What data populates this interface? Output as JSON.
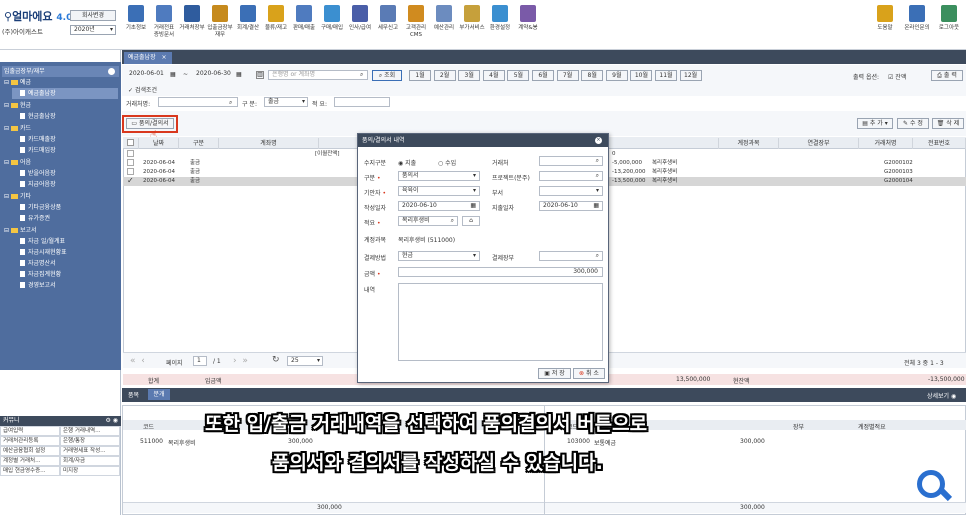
{
  "app": {
    "logo_text": "얼마에요",
    "version": "4.0",
    "company": "(주)아이캐스트",
    "company_change_btn": "회사변경",
    "year": "2020년"
  },
  "toolbar": [
    "기초정보",
    "거래전표\n증빙문서",
    "거래처장부",
    "입출금장부\n재무",
    "회계/결산",
    "물류/재고",
    "판매/매출",
    "구매/매입",
    "인사/급여",
    "세무신고",
    "고객관리\nCMS",
    "예산관리",
    "부가서비스",
    "환경설정",
    "계약&봉"
  ],
  "toolbar_right": [
    "도움말",
    "온라인문의",
    "로그아웃"
  ],
  "menu": {
    "title": "메 뉴",
    "sections": [
      {
        "label": "입출금장부/재무"
      },
      {
        "label": "예금",
        "items": [
          "예금출납장"
        ]
      },
      {
        "label": "현금",
        "items": [
          "현금출납장"
        ]
      },
      {
        "label": "카드",
        "items": [
          "카드매출장",
          "카드매입장"
        ]
      },
      {
        "label": "어음",
        "items": [
          "받을어음장",
          "지급어음장"
        ]
      },
      {
        "label": "기타",
        "items": [
          "기타금융상품",
          "유가증권"
        ]
      },
      {
        "label": "보고서",
        "items": [
          "자금 일/월계표",
          "자금시재현황표",
          "자금명산서",
          "자금집계현황",
          "경영보고서"
        ]
      }
    ]
  },
  "bottom_left": {
    "title": "커뮤니",
    "rows": [
      [
        "급여입력",
        "은행 거래내역…"
      ],
      [
        "거래처관리등록",
        "은행/통장"
      ],
      [
        "예산금융협회 설정",
        "거래명세표 작성…"
      ],
      [
        "계정별 거래처…",
        "회계/자금"
      ],
      [
        "매입 현금영수증…",
        "미지장"
      ]
    ]
  },
  "tab": {
    "label": "예금출납장",
    "close": "×"
  },
  "filter": {
    "date_from": "2020-06-01",
    "tilde": "~",
    "date_to": "2020-06-30",
    "bank_placeholder": "은행명 or 계좌명",
    "search_btn": "조회",
    "months": [
      "1월",
      "2월",
      "3월",
      "4월",
      "5월",
      "6월",
      "7월",
      "8월",
      "9월",
      "10월",
      "11월",
      "12월"
    ],
    "search_cond": "검색조건",
    "output_option_label": "출력 옵션:",
    "balance_check": "잔액",
    "print_btn": "출 력",
    "vendor_label": "거래처명:",
    "type_label": "구 분:",
    "type_value": "출금",
    "memo_label": "적 요:"
  },
  "grid": {
    "approval_btn": "품의/결의서",
    "add_btn": "추 가",
    "edit_btn": "수 정",
    "delete_btn": "삭 제",
    "headers": [
      "날짜",
      "구분",
      "계좌명",
      "",
      "",
      "",
      "계정과목",
      "연결장부",
      "거래처명",
      "전표번호",
      "품의/결의서"
    ],
    "rows": [
      {
        "date": "",
        "type": "",
        "account": "[이월잔액]",
        "amount": "0",
        "subject": "",
        "voucher": ""
      },
      {
        "date": "2020-06-04",
        "type": "출금",
        "account": "",
        "amount": "-5,000,000",
        "subject": "복리후생비",
        "voucher": "G2000102"
      },
      {
        "date": "2020-06-04",
        "type": "출금",
        "account": "",
        "amount": "-13,200,000",
        "subject": "복리후생비",
        "voucher": "G2000103"
      },
      {
        "date": "2020-06-04",
        "type": "출금",
        "account": "",
        "amount": "-13,500,000",
        "subject": "복리후생비",
        "voucher": "G2000104"
      }
    ],
    "pager": {
      "page_label": "페이지",
      "page": "1",
      "total_pages": "/ 1",
      "per_page": "25",
      "total_text": "전체 3 중 1 - 3"
    },
    "sum_label": "합계",
    "sum_in_label": "입금액",
    "sum_out_value": "13,500,000",
    "balance_label": "현잔액",
    "balance_value": "-13,500,000"
  },
  "detail": {
    "tabs": [
      "품목",
      "분개"
    ],
    "detail_toggle": "상세보기",
    "headers_left": [
      "코드",
      "계정과목",
      "금액"
    ],
    "headers_right": [
      "코드",
      "계정과목",
      "금액",
      "장부",
      "계정별적요"
    ],
    "row_left": {
      "code": "511000",
      "subject": "복리후생비",
      "amount": "300,000"
    },
    "row_right": {
      "code": "103000",
      "subject": "보통예금",
      "amount": "300,000"
    },
    "total_left": "300,000",
    "total_right": "300,000"
  },
  "modal": {
    "title": "품의/결의서 내역",
    "io_label": "수지구분",
    "io_out": "지출",
    "io_in": "수입",
    "vendor_label": "거래처",
    "kind_label": "구분",
    "kind_value": "품의서",
    "project_label": "프로젝트(분주)",
    "drafter_label": "기안자",
    "drafter_value": "육육이",
    "dept_label": "부서",
    "write_date_label": "작성일자",
    "write_date": "2020-06-10",
    "pay_date_label": "지출일자",
    "pay_date": "2020-06-10",
    "memo_label": "적요",
    "memo_value": "복리후생비",
    "subject_label": "계정과목",
    "subject_value": "복리후생비 (511000)",
    "paymethod_label": "결제방법",
    "paymethod_value": "현금",
    "payledger_label": "결제장부",
    "amount_label": "금액",
    "amount_value": "300,000",
    "content_label": "내역",
    "save_btn": "저 장",
    "cancel_btn": "취 소"
  },
  "caption": {
    "line1": "또한 입/출금 거래내역을 선택하여 품의결의서 버튼으로",
    "line2": "품의서와 결의서를 작성하실 수 있습니다."
  },
  "colors": {
    "nav_dark": "#3d4a5c",
    "menu_blue": "#4f6d9e",
    "highlight_red": "#d9381e"
  }
}
